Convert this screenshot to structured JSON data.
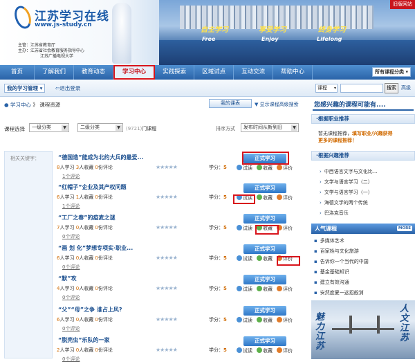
{
  "header": {
    "logo_title": "江苏学习在线",
    "logo_url": "www.js-study.cn",
    "sponsors": [
      "主管：江苏省教育厅",
      "主办：江苏省社会教育服务指导中心",
      "江苏广播电视大学"
    ],
    "slogans": [
      {
        "cn": "自主学习",
        "en": "Free"
      },
      {
        "cn": "享受学习",
        "en": "Enjoy"
      },
      {
        "cn": "终身学习",
        "en": "Lifelong"
      }
    ],
    "old_site": "旧版网站"
  },
  "nav": {
    "items": [
      "首页",
      "了解我们",
      "教育动态",
      "学习中心",
      "实践探索",
      "区域试点",
      "互动交流",
      "帮助中心"
    ],
    "active_index": 3,
    "course_select": "所有课程分类"
  },
  "subbar": {
    "my_management": "我的学习管理",
    "logout": "退出登录",
    "search_type": "课程",
    "search_button": "搜索",
    "advanced": "高级"
  },
  "breadcrumb": {
    "home": "学习中心",
    "sep": "》",
    "current": "课程资源"
  },
  "tools": {
    "my_courses": "我的课表",
    "show_search": "显示课程高级搜索"
  },
  "filter": {
    "label": "课程选择",
    "cat1": "一级分类",
    "cat2": "二级分类",
    "count": "(9721)",
    "count_unit": "门课程",
    "sort_label": "排序方式",
    "sort_value": "发布时间从新到旧"
  },
  "keywords_label": "相关关键字：",
  "labels": {
    "learn_suffix": "人学习",
    "fav_suffix": "人收藏",
    "review_suffix": "份评论",
    "credit": "学分：",
    "comment_suffix": "个评论",
    "formal": "正式学习",
    "try": "试读",
    "fav": "收藏",
    "eval": "评价"
  },
  "courses": [
    {
      "title": "“德国造”能成为北约大兵的最爱...",
      "learners": "8",
      "favorites": "3",
      "reviews": "0",
      "credit": "5",
      "comments": "1",
      "stars": "★★★★★"
    },
    {
      "title": "“红帽子”企业及其产权问题",
      "learners": "6",
      "favorites": "1",
      "reviews": "0",
      "credit": "5",
      "comments": "1",
      "stars": "★★★★★"
    },
    {
      "title": "“工厂之春”的疫麦之谜",
      "learners": "7",
      "favorites": "0",
      "reviews": "0",
      "credit": "5",
      "comments": "0",
      "stars": "★★★★★"
    },
    {
      "title": "“画 划 化”梦想专项实·职业...",
      "learners": "6",
      "favorites": "0",
      "reviews": "0",
      "credit": "5",
      "comments": "0",
      "stars": "★★★★★"
    },
    {
      "title": "“默”攻",
      "learners": "4",
      "favorites": "0",
      "reviews": "0",
      "credit": "5",
      "comments": "0",
      "stars": "★★★★★"
    },
    {
      "title": "“父”“母”之争 谁占上风?",
      "learners": "6",
      "favorites": "0",
      "reviews": "0",
      "credit": "5",
      "comments": "0",
      "stars": "★★★★★"
    },
    {
      "title": "“脱壳虫”乐队的一家",
      "learners": "2",
      "favorites": "0",
      "reviews": "0",
      "credit": "5",
      "comments": "0",
      "stars": "★★★★★"
    }
  ],
  "right": {
    "title": "您感兴趣的课程可能有....",
    "career_head": "·根据职业推荐",
    "career_text_pre": "暂无课程推荐，",
    "career_link": "填写职业/兴趣获得",
    "career_text_post": "更多的课程推荐！",
    "interest_head": "·根据兴趣推荐",
    "interest_items": [
      "中西语言文字与文化比...",
      "文学与语言学习（二）",
      "文学与语言学习（一）",
      "海德文学的两个传统",
      "巴洛克音乐"
    ],
    "popular_head": "人气课程",
    "more": "MORE",
    "popular_items": [
      "多媒体艺术",
      "百家姓与文化旅游",
      "告诉你一个当代的中国",
      "基金基础知识",
      "建立有效沟通",
      "安然度夏一这招般消"
    ],
    "photo_text": [
      "魅力江苏",
      "人文江苏"
    ]
  }
}
